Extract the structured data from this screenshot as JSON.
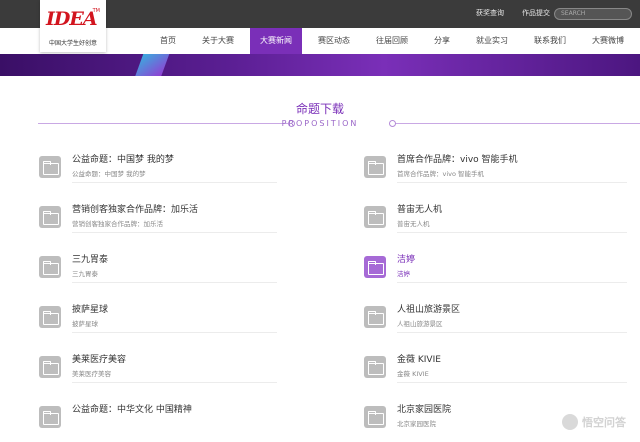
{
  "topbar": {
    "links": [
      "获奖查询",
      "作品提交"
    ],
    "search_placeholder": "SEARCH"
  },
  "logo": {
    "mark": "IDEA",
    "tm": "TM",
    "subtitle": "中国大学生好创意"
  },
  "nav": {
    "items": [
      {
        "label": "首页"
      },
      {
        "label": "关于大赛"
      },
      {
        "label": "大赛新闻",
        "active": true
      },
      {
        "label": "赛区动态"
      },
      {
        "label": "往届回顾"
      },
      {
        "label": "分享"
      },
      {
        "label": "就业实习"
      },
      {
        "label": "联系我们"
      },
      {
        "label": "大赛微博"
      }
    ]
  },
  "section": {
    "title": "命题下载",
    "subtitle": "PROPOSITION"
  },
  "left_items": [
    {
      "title": "公益命题：中国梦 我的梦",
      "sub": "公益命题：中国梦 我的梦"
    },
    {
      "title": "营销创客独家合作品牌：加乐活",
      "sub": "营销创客独家合作品牌：加乐活"
    },
    {
      "title": "三九胃泰",
      "sub": "三九胃泰"
    },
    {
      "title": "披萨星球",
      "sub": "披萨星球"
    },
    {
      "title": "美莱医疗美容",
      "sub": "美莱医疗美容"
    },
    {
      "title": "公益命题：中华文化 中国精神",
      "sub": ""
    }
  ],
  "right_items": [
    {
      "title": "首席合作品牌：vivo 智能手机",
      "sub": "首席合作品牌：vivo 智能手机"
    },
    {
      "title": "普宙无人机",
      "sub": "普宙无人机"
    },
    {
      "title": "洁婷",
      "sub": "洁婷",
      "highlight": true
    },
    {
      "title": "人祖山旅游景区",
      "sub": "人祖山旅游景区"
    },
    {
      "title": "金薇 KIVIE",
      "sub": "金薇 KIVIE"
    },
    {
      "title": "北京家园医院",
      "sub": "北京家园医院"
    }
  ],
  "watermark": "悟空问答",
  "colors": {
    "accent": "#7a2fb8",
    "topbar": "#3b3b3b",
    "icon_gray": "#bdbdbd",
    "icon_purple": "#a66ad6"
  }
}
